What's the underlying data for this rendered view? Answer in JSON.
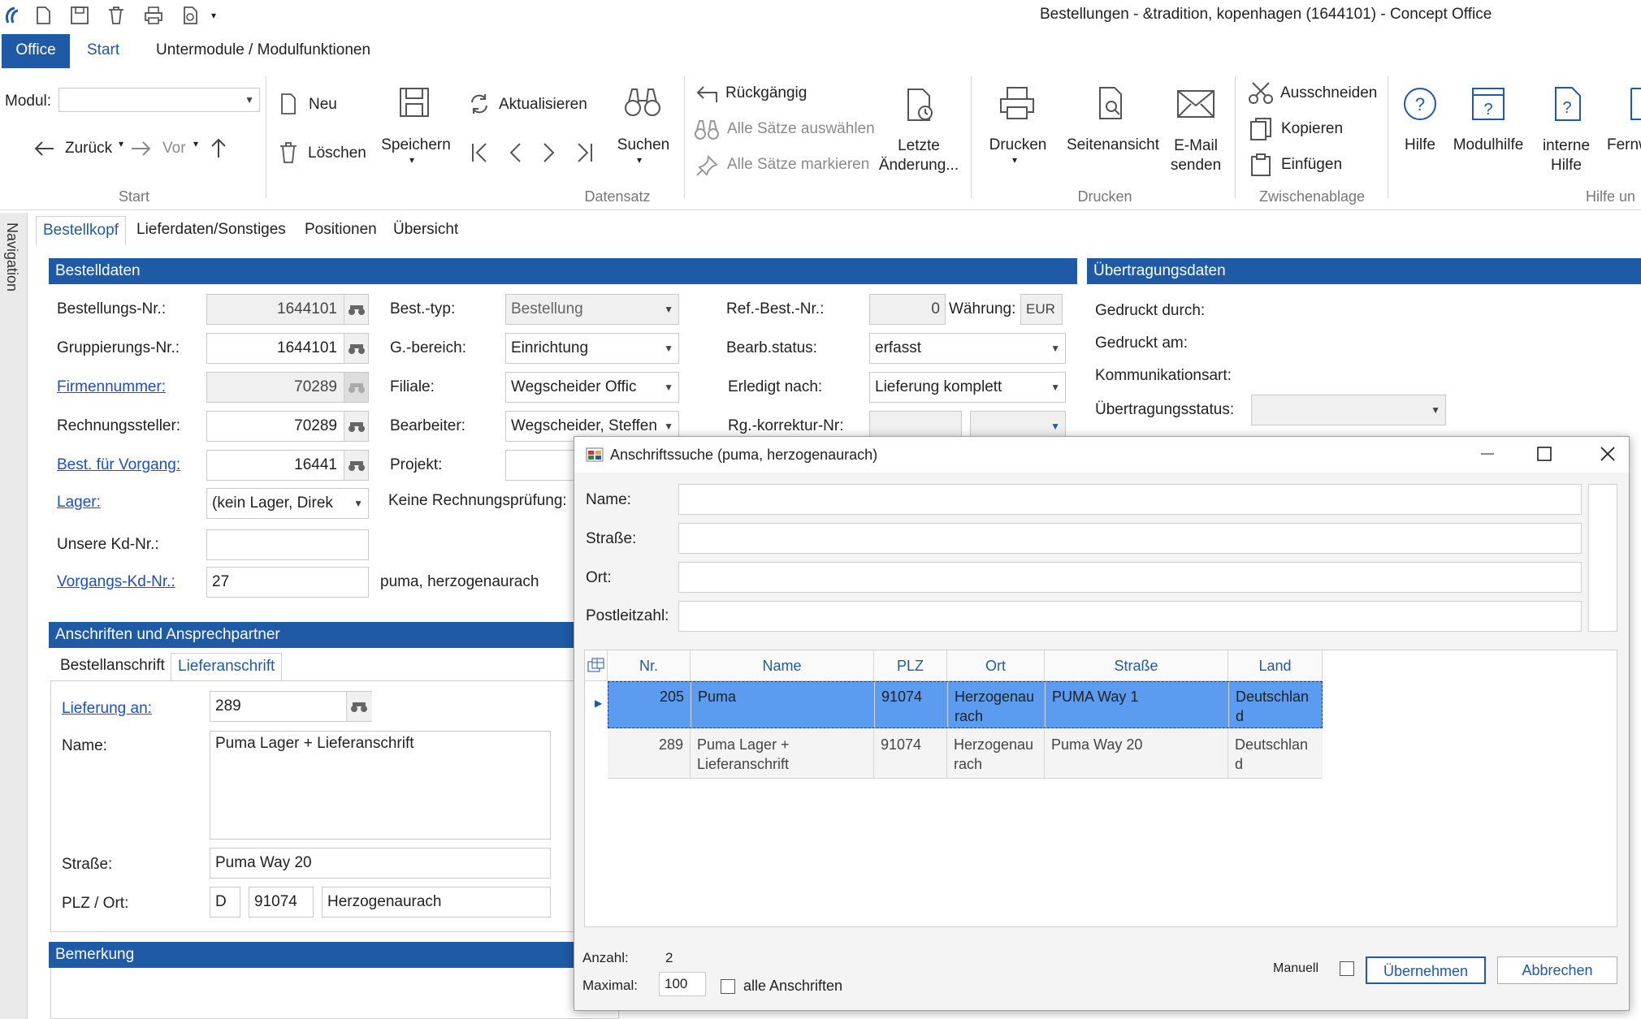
{
  "window": {
    "title": "Bestellungen - &tradition, kopenhagen (1644101) - Concept Office"
  },
  "menu": {
    "office": "Office",
    "start": "Start",
    "untermodule": "Untermodule / Modulfunktionen"
  },
  "ribbon": {
    "modul_label": "Modul:",
    "modul_value": "",
    "zurueck": "Zurück",
    "vor": "Vor",
    "neu": "Neu",
    "loeschen": "Löschen",
    "speichern": "Speichern",
    "aktualisieren": "Aktualisieren",
    "suchen": "Suchen",
    "rueckgaengig": "Rückgängig",
    "alle_saetze_auswaehlen": "Alle Sätze auswählen",
    "alle_saetze_markieren": "Alle Sätze markieren",
    "letzte_aenderung_1": "Letzte",
    "letzte_aenderung_2": "Änderung...",
    "drucken": "Drucken",
    "seitenansicht": "Seitenansicht",
    "email_1": "E-Mail",
    "email_2": "senden",
    "ausschneiden": "Ausschneiden",
    "kopieren": "Kopieren",
    "einfuegen": "Einfügen",
    "hilfe": "Hilfe",
    "modulhilfe": "Modulhilfe",
    "interne_1": "interne",
    "interne_2": "Hilfe",
    "fernw": "Fernw",
    "groups": {
      "start": "Start",
      "datensatz": "Datensatz",
      "drucken": "Drucken",
      "zwischenablage": "Zwischenablage",
      "hilfe": "Hilfe un"
    }
  },
  "nav": {
    "label": "Navigation"
  },
  "tabs": [
    "Bestellkopf",
    "Lieferdaten/Sonstiges",
    "Positionen",
    "Übersicht"
  ],
  "bestelldaten": {
    "header": "Bestelldaten",
    "bestellungs_nr_label": "Bestellungs-Nr.:",
    "bestellungs_nr": "1644101",
    "gruppierungs_nr_label": "Gruppierungs-Nr.:",
    "gruppierungs_nr": "1644101",
    "firmennummer_label": "Firmennummer:",
    "firmennummer": "70289",
    "rechnungssteller_label": "Rechnungssteller:",
    "rechnungssteller": "70289",
    "best_fuer_vorgang_label": "Best. für Vorgang:",
    "best_fuer_vorgang": "16441",
    "lager_label": "Lager:",
    "lager": "(kein Lager, Direk",
    "unsere_kd_nr_label": "Unsere Kd-Nr.:",
    "unsere_kd_nr": "",
    "vorgangs_kd_nr_label": "Vorgangs-Kd-Nr.:",
    "vorgangs_kd_nr": "27",
    "vorgangs_kd_name": "puma, herzogenaurach",
    "best_typ_label": "Best.-typ:",
    "best_typ": "Bestellung",
    "g_bereich_label": "G.-bereich:",
    "g_bereich": "Einrichtung",
    "filiale_label": "Filiale:",
    "filiale": "Wegscheider Offic",
    "bearbeiter_label": "Bearbeiter:",
    "bearbeiter": "Wegscheider, Steffen",
    "projekt_label": "Projekt:",
    "keine_rp_label": "Keine Rechnungsprüfung:",
    "ref_best_nr_label": "Ref.-Best.-Nr.:",
    "ref_best_nr": "0",
    "waehrung_label": "Währung:",
    "waehrung": "EUR",
    "bearb_status_label": "Bearb.status:",
    "bearb_status": "erfasst",
    "erledigt_nach_label": "Erledigt nach:",
    "erledigt_nach": "Lieferung komplett",
    "rg_korrektur_label": "Rg.-korrektur-Nr:"
  },
  "uebertragung": {
    "header": "Übertragungsdaten",
    "gedruckt_durch": "Gedruckt durch:",
    "gedruckt_am": "Gedruckt am:",
    "kommunikationsart": "Kommunikationsart:",
    "uebertragungsstatus": "Übertragungsstatus:"
  },
  "anschriften": {
    "header": "Anschriften und Ansprechpartner",
    "tab_bestell": "Bestellanschrift",
    "tab_liefer": "Lieferanschrift",
    "lieferung_an_label": "Lieferung an:",
    "lieferung_an": "289",
    "name_label": "Name:",
    "name": "Puma Lager + Lieferanschrift",
    "strasse_label": "Straße:",
    "strasse": "Puma Way 20",
    "plz_ort_label": "PLZ / Ort:",
    "land": "D",
    "plz": "91074",
    "ort": "Herzogenaurach"
  },
  "bemerkung": {
    "header": "Bemerkung"
  },
  "dialog": {
    "title": "Anschriftssuche (puma, herzogenaurach)",
    "name_label": "Name:",
    "strasse_label": "Straße:",
    "ort_label": "Ort:",
    "plz_label": "Postleitzahl:",
    "columns": [
      "Nr.",
      "Name",
      "PLZ",
      "Ort",
      "Straße",
      "Land"
    ],
    "rows": [
      {
        "nr": "205",
        "name": "Puma",
        "plz": "91074",
        "ort": "Herzogenaurach",
        "strasse": "PUMA Way 1",
        "land": "Deutschland"
      },
      {
        "nr": "289",
        "name": "Puma Lager + Lieferanschrift",
        "plz": "91074",
        "ort": "Herzogenaurach",
        "strasse": "Puma Way 20",
        "land": "Deutschland"
      }
    ],
    "anzahl_label": "Anzahl:",
    "anzahl": "2",
    "maximal_label": "Maximal:",
    "maximal": "100",
    "alle_anschriften": "alle Anschriften",
    "manuell": "Manuell",
    "uebernehmen": "Übernehmen",
    "abbrechen": "Abbrechen"
  }
}
